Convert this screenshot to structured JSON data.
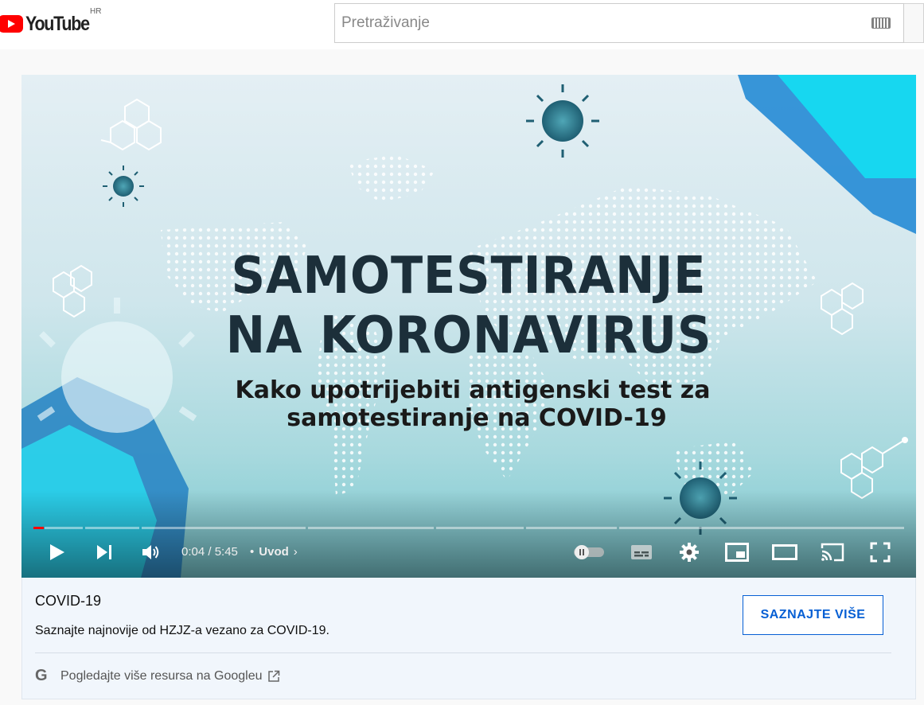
{
  "header": {
    "logo_text": "YouTube",
    "country_code": "HR",
    "search_placeholder": "Pretraživanje"
  },
  "video": {
    "title_line1": "SAMOTESTIRANJE",
    "title_line2": "NA KORONAVIRUS",
    "subtitle_line1": "Kako upotrijebiti antigenski test za",
    "subtitle_line2": "samotestiranje na COVID-19",
    "progress_fraction": 0.012,
    "time": "0:04 / 5:45",
    "chapter_separator": "•",
    "chapter": "Uvod",
    "chapter_chevron": "›"
  },
  "controls": {
    "icons": [
      "play-icon",
      "next-icon",
      "volume-icon",
      "autoplay-toggle-icon",
      "subtitles-icon",
      "settings-icon",
      "miniplayer-icon",
      "theater-icon",
      "cast-icon",
      "fullscreen-icon"
    ]
  },
  "info_panel": {
    "title": "COVID-19",
    "description": "Saznajte najnovije od HZJZ-a vezano za COVID-19.",
    "button_label": "SAZNAJTE VIŠE",
    "google_letter": "G",
    "google_link": "Pogledajte više resursa na Googleu"
  },
  "colors": {
    "accent_blue": "#065fd4",
    "progress_red": "#ff0000",
    "youtube_red": "#ff0000"
  }
}
